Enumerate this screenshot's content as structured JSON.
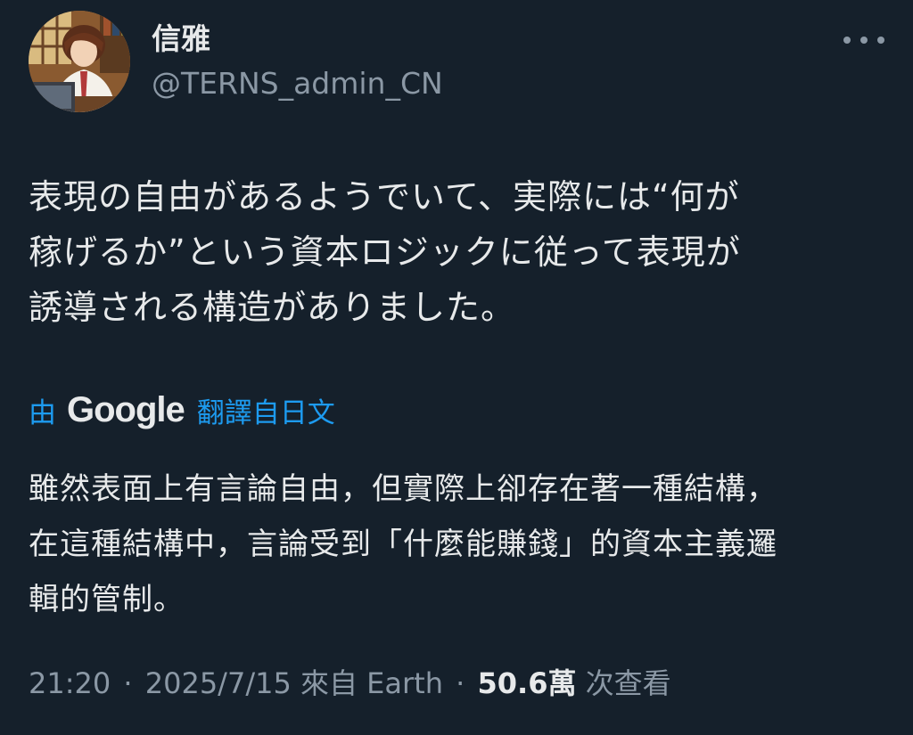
{
  "author": {
    "display_name": "信雅",
    "handle": "@TERNS_admin_CN",
    "avatar_icon": "avatar-illustration"
  },
  "more_icon": "more-horizontal-icon",
  "tweet": {
    "lines": [
      "表現の自由があるようでいて、実際には“何が",
      "稼げるか”という資本ロジックに従って表現が",
      "誘導される構造がありました。"
    ]
  },
  "translation": {
    "by_label": "由",
    "provider": "Google",
    "from_label": "翻譯自日文",
    "lines": [
      "雖然表面上有言論自由，但實際上卻存在著一種結構，",
      "在這種結構中，言論受到「什麼能賺錢」的資本主義邏",
      "輯的管制。"
    ]
  },
  "meta": {
    "time": "21:20",
    "dot1": "·",
    "date": "2025/7/15",
    "source": "來自 Earth",
    "dot2": "·",
    "views_count": "50.6萬",
    "views_label": "次查看"
  },
  "colors": {
    "background": "#15202b",
    "text_primary": "#e7e9ea",
    "text_secondary": "#8b98a5",
    "link": "#1d9bf0"
  }
}
